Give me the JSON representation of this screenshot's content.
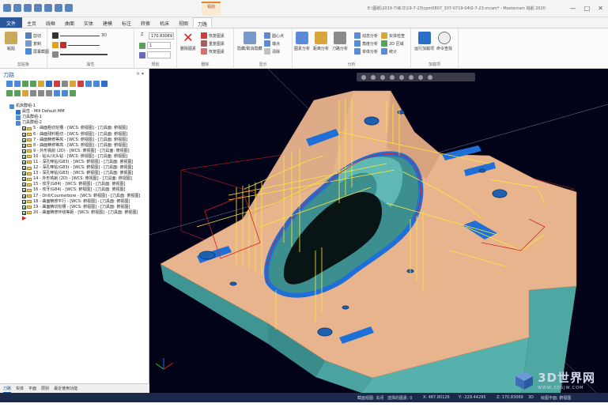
{
  "window": {
    "title": "E:\\图纸\\2019-7\\练习\\19-7-23\\cpm0807_307-0719-04\\0-7-23.mcam* - Mastercam 铣削 2020",
    "context_tab": "铣削",
    "context_tab2": "刀路",
    "controls": [
      "—",
      "□",
      "✕"
    ]
  },
  "ribbon_tabs": [
    "文件",
    "主页",
    "线框",
    "曲面",
    "实体",
    "建模",
    "标注",
    "转换",
    "机床",
    "视图",
    "刀路"
  ],
  "ribbon": {
    "clipboard": {
      "label": "剪贴板",
      "paste": "粘贴",
      "cut": "剪切",
      "copy": "复制",
      "paste_special": "屏幕截图"
    },
    "attributes": {
      "label": "属性",
      "line_width": "3D"
    },
    "planes": {
      "label": "规划",
      "z_label": "Z",
      "z_value": "170.83069",
      "layer_value": "1"
    },
    "delete": {
      "label": "删除",
      "delete_btn": "删除图素",
      "undelete": "恢复图素",
      "dup": "重复图素",
      "restore": "恢复图素"
    },
    "display": {
      "label": "显示",
      "hide": "隐藏/取消隐藏",
      "arc_center": "圆心点",
      "endpoint": "端点",
      "clear": "清除"
    },
    "analysis": {
      "label": "分析",
      "entity": "图素分析",
      "distance": "距离分析",
      "toolpath": "刀路分析",
      "dynamic": "动态分析",
      "angle": "角度分析",
      "single": "单体分析",
      "check_solid": "实体检查",
      "area_2d": "2D 区域",
      "stats": "统计"
    },
    "addins": {
      "label": "加载项",
      "run": "运行加载项",
      "find": "命令查找"
    }
  },
  "panel": {
    "title": "刀路",
    "close": "× ▾",
    "tree": [
      {
        "label": "机床群组-1",
        "indent": 0,
        "kind": "group"
      },
      {
        "label": "属性 - Mill Default MM",
        "indent": 1,
        "kind": "prop"
      },
      {
        "label": "刀具群组-1",
        "indent": 1,
        "kind": "group"
      },
      {
        "label": "刀具群组-2",
        "indent": 1,
        "kind": "group"
      },
      {
        "label": "5 - 曲面粗切挖槽 - [WCS: 俯视图] - [刀具面: 俯视图]",
        "indent": 2,
        "kind": "op"
      },
      {
        "label": "6 - 曲面残料粗切 - [WCS: 俯视图] - [刀具面: 俯视图]",
        "indent": 2,
        "kind": "op"
      },
      {
        "label": "7 - 曲面精修等高 - [WCS: 俯视图] - [刀具面: 俯视图]",
        "indent": 2,
        "kind": "op"
      },
      {
        "label": "8 - 曲面精修等高 - [WCS: 俯视图] - [刀具面: 俯视图]",
        "indent": 2,
        "kind": "op"
      },
      {
        "label": "9 - 外形铣削 (2D) - [WCS: 俯视图] - [刀具面: 俯视图]",
        "indent": 2,
        "kind": "op"
      },
      {
        "label": "10 - 钻头/沉头钻 - [WCS: 俯视图] - [刀具面: 俯视图]",
        "indent": 2,
        "kind": "op"
      },
      {
        "label": "11 - 深孔啄钻(G83) - [WCS: 俯视图] - [刀具面: 俯视图]",
        "indent": 2,
        "kind": "op"
      },
      {
        "label": "12 - 深孔啄钻(G83) - [WCS: 俯视图] - [刀具面: 俯视图]",
        "indent": 2,
        "kind": "op"
      },
      {
        "label": "13 - 深孔啄钻(G83) - [WCS: 俯视图] - [刀具面: 俯视图]",
        "indent": 2,
        "kind": "op"
      },
      {
        "label": "14 - 外形铣削 (2D) - [WCS: 俯视图] - [刀具面: 俯视图]",
        "indent": 2,
        "kind": "op"
      },
      {
        "label": "15 - 攻牙(G84) - [WCS: 俯视图] - [刀具面: 俯视图]",
        "indent": 2,
        "kind": "op"
      },
      {
        "label": "16 - 攻牙(G84) - [WCS: 俯视图] - [刀具面: 俯视图]",
        "indent": 2,
        "kind": "op"
      },
      {
        "label": "17 - Drill/Counterbore - [WCS: 俯视图] - [刀具面: 俯视图]",
        "indent": 2,
        "kind": "op"
      },
      {
        "label": "18 - 曲面精修平行 - [WCS: 俯视图] - [刀具面: 俯视图]",
        "indent": 2,
        "kind": "op"
      },
      {
        "label": "19 - 曲面精切挖槽 - [WCS: 俯视图] - [刀具面: 俯视图]",
        "indent": 2,
        "kind": "op"
      },
      {
        "label": "20 - 曲面精修环绕等距 - [WCS: 俯视图] - [刀具面: 俯视图]",
        "indent": 2,
        "kind": "op"
      }
    ],
    "bottom_tabs": [
      "刀路",
      "实体",
      "平面",
      "层别",
      "最近使用功能"
    ]
  },
  "status": {
    "section_view": "截面视图: 关闭",
    "selection": "选择的图素: 0",
    "x": "X: 487.80126",
    "y": "Y: -229.44295",
    "z": "Z: 170.83069",
    "mode": "3D",
    "plane": "绘图平面: 俯视图"
  },
  "watermark": {
    "text": "3D世界网",
    "url": "WWW.3DSJW.COM"
  },
  "colors": {
    "accent": "#2b579a",
    "viewport_bg": "#020218",
    "part_top": "#e8b48e",
    "part_side": "#4fa7a4",
    "toolpath_yellow": "#ffe833",
    "toolpath_blue": "#1e6fd8",
    "boundary_red": "#d81e1e"
  }
}
